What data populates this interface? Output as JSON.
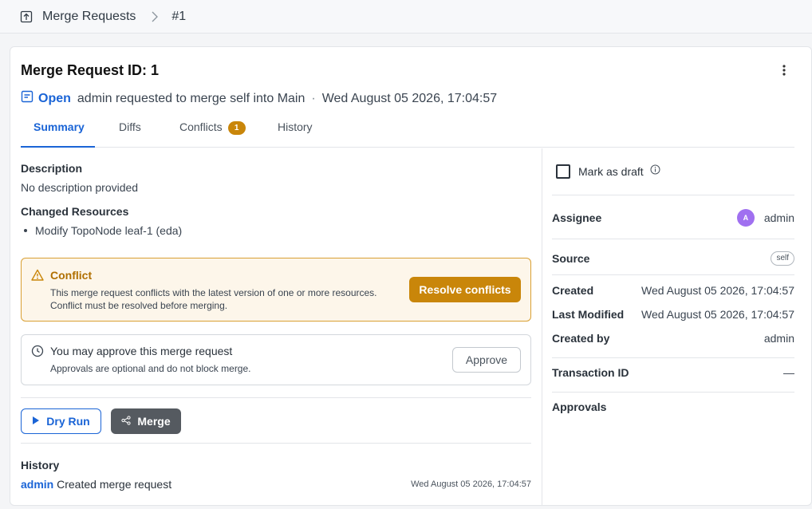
{
  "breadcrumb": {
    "section": "Merge Requests",
    "current": "#1"
  },
  "header": {
    "title": "Merge Request ID: 1",
    "status": "Open",
    "summary": "admin requested to merge self into Main",
    "separator": "·",
    "timestamp": "Wed August 05 2026, 17:04:57"
  },
  "tabs": [
    {
      "label": "Summary"
    },
    {
      "label": "Diffs"
    },
    {
      "label": "Conflicts",
      "badge": "1"
    },
    {
      "label": "History"
    }
  ],
  "summary": {
    "description_label": "Description",
    "description": "No description provided",
    "changed_label": "Changed Resources",
    "changed": [
      "Modify TopoNode leaf-1 (eda)"
    ]
  },
  "conflict": {
    "title": "Conflict",
    "line1": "This merge request conflicts with the latest version of one or more resources.",
    "line2": "Conflict must be resolved before merging.",
    "button": "Resolve conflicts"
  },
  "approval": {
    "title": "You may approve this merge request",
    "subtitle": "Approvals are optional and do not block merge.",
    "button": "Approve"
  },
  "actions": {
    "dry_run": "Dry Run",
    "merge": "Merge"
  },
  "history": {
    "label": "History",
    "entries": [
      {
        "user": "admin",
        "action": "Created merge request",
        "time": "Wed August 05 2026, 17:04:57"
      }
    ]
  },
  "details": {
    "draft_label": "Mark as draft",
    "assignee_label": "Assignee",
    "assignee_initial": "A",
    "assignee": "admin",
    "source_label": "Source",
    "source": "self",
    "created_label": "Created",
    "created": "Wed August 05 2026, 17:04:57",
    "modified_label": "Last Modified",
    "modified": "Wed August 05 2026, 17:04:57",
    "created_by_label": "Created by",
    "created_by": "admin",
    "transaction_label": "Transaction ID",
    "transaction": "—",
    "approvals_label": "Approvals"
  },
  "colors": {
    "accent": "#1a64d6",
    "warning": "#c9860a",
    "avatar": "#a070f0"
  }
}
